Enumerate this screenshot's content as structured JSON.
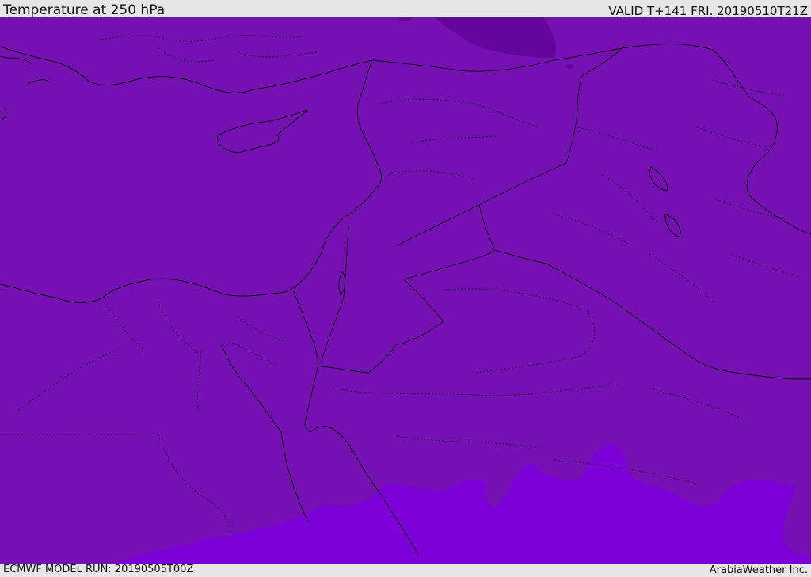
{
  "header": {
    "title": "Temperature at 250 hPa",
    "valid": "VALID T+141 FRI. 20190510T21Z"
  },
  "footer": {
    "model_run": "ECMWF MODEL RUN: 20190505T00Z",
    "credit": "ArabiaWeather Inc."
  },
  "map": {
    "field": "temperature-250hPa",
    "colors": {
      "main": "#7510b2",
      "cold_north": "#64069c",
      "warm_south": "#7d00d8",
      "lines": "#111111"
    }
  }
}
